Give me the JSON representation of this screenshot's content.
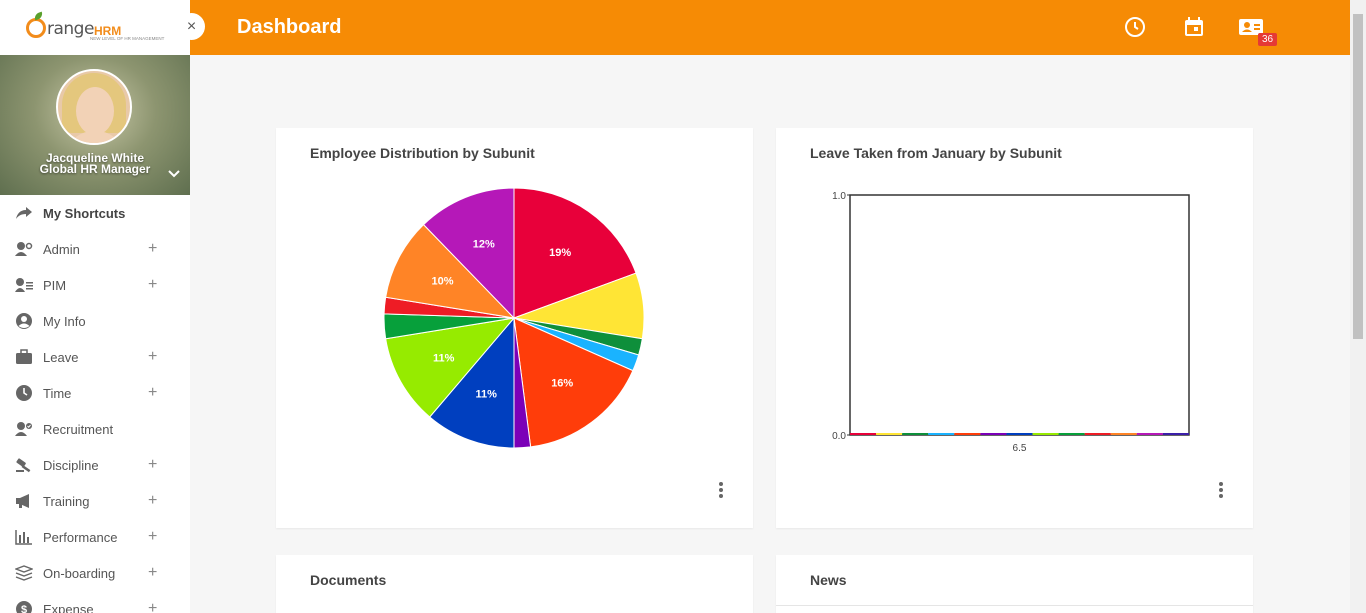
{
  "brand": {
    "logo_main": "range",
    "logo_suffix": "HRM",
    "tagline": "NEW LEVEL OF HR MANAGEMENT"
  },
  "sidebar": {
    "close_glyph": "×",
    "profile": {
      "name": "Jacqueline White",
      "role": "Global HR Manager"
    },
    "items": [
      {
        "label": "My Shortcuts",
        "icon": "share-arrow-icon",
        "expandable": false
      },
      {
        "label": "Admin",
        "icon": "user-gear-icon",
        "expandable": true
      },
      {
        "label": "PIM",
        "icon": "user-list-icon",
        "expandable": true
      },
      {
        "label": "My Info",
        "icon": "user-circle-icon",
        "expandable": false
      },
      {
        "label": "Leave",
        "icon": "briefcase-icon",
        "expandable": true
      },
      {
        "label": "Time",
        "icon": "clock-icon",
        "expandable": true
      },
      {
        "label": "Recruitment",
        "icon": "user-check-icon",
        "expandable": false
      },
      {
        "label": "Discipline",
        "icon": "gavel-icon",
        "expandable": true
      },
      {
        "label": "Training",
        "icon": "megaphone-icon",
        "expandable": true
      },
      {
        "label": "Performance",
        "icon": "bar-chart-icon",
        "expandable": true
      },
      {
        "label": "On-boarding",
        "icon": "layers-icon",
        "expandable": true
      },
      {
        "label": "Expense",
        "icon": "dollar-icon",
        "expandable": true
      }
    ]
  },
  "topbar": {
    "title": "Dashboard",
    "notification_count": "36"
  },
  "cards": {
    "employee_distribution": {
      "title": "Employee Distribution by Subunit"
    },
    "leave_taken": {
      "title": "Leave Taken from January by Subunit"
    },
    "documents": {
      "title": "Documents"
    },
    "news": {
      "title": "News"
    }
  },
  "chart_data": [
    {
      "type": "pie",
      "title": "Employee Distribution by Subunit",
      "slices": [
        {
          "value": 19,
          "label": "19%",
          "color": "#e8003a"
        },
        {
          "value": 8,
          "label": "",
          "color": "#ffe535"
        },
        {
          "value": 2,
          "label": "",
          "color": "#0e8f3b"
        },
        {
          "value": 2,
          "label": "",
          "color": "#1ab3ff"
        },
        {
          "value": 16,
          "label": "16%",
          "color": "#ff3d0a"
        },
        {
          "value": 2,
          "label": "",
          "color": "#7b00b8"
        },
        {
          "value": 11,
          "label": "11%",
          "color": "#003fbf"
        },
        {
          "value": 11,
          "label": "11%",
          "color": "#96eb00"
        },
        {
          "value": 3,
          "label": "",
          "color": "#07a03b"
        },
        {
          "value": 2,
          "label": "",
          "color": "#ee1c25"
        },
        {
          "value": 10,
          "label": "10%",
          "color": "#ff8426"
        },
        {
          "value": 12,
          "label": "12%",
          "color": "#b518b8"
        }
      ]
    },
    {
      "type": "bar",
      "title": "Leave Taken from January by Subunit",
      "ylim": [
        0,
        1
      ],
      "yticks": [
        "1.0",
        "0.0"
      ],
      "xticks": [
        "6.5"
      ],
      "series_colors": [
        "#e8003a",
        "#ffe535",
        "#0e8f3b",
        "#1ab3ff",
        "#ff3d0a",
        "#7b00b8",
        "#003fbf",
        "#96eb00",
        "#07a03b",
        "#ee1c25",
        "#ff8426",
        "#b518b8",
        "#3b1fa8"
      ],
      "values": [
        0,
        0,
        0,
        0,
        0,
        0,
        0,
        0,
        0,
        0,
        0,
        0,
        0
      ]
    }
  ]
}
